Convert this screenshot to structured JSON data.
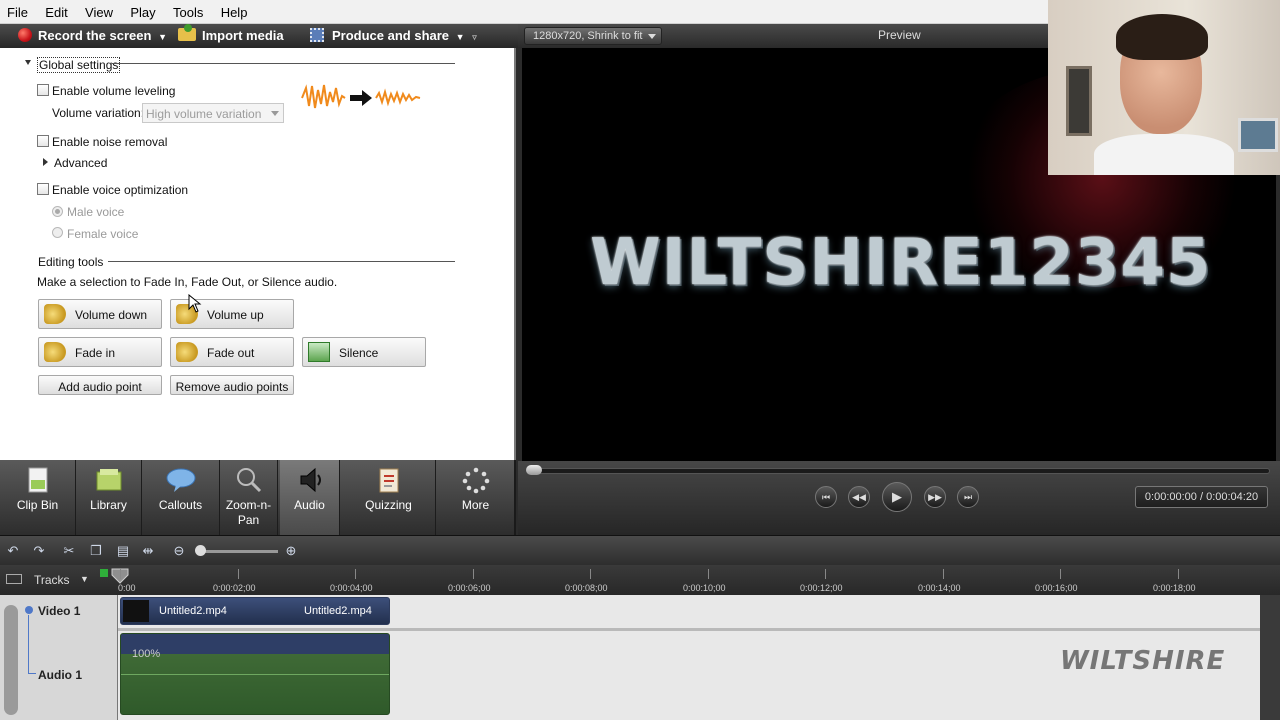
{
  "menu": [
    "File",
    "Edit",
    "View",
    "Play",
    "Tools",
    "Help"
  ],
  "toolbar": {
    "record": "Record the screen",
    "import": "Import media",
    "produce": "Produce and share"
  },
  "audio_panel": {
    "global_settings": "Global settings",
    "volume_leveling": "Enable volume leveling",
    "volume_variation_label": "Volume variation:",
    "volume_variation_value": "High volume variation",
    "noise_removal": "Enable noise removal",
    "advanced": "Advanced",
    "voice_optimization": "Enable voice optimization",
    "male_voice": "Male voice",
    "female_voice": "Female voice",
    "editing_tools": "Editing tools",
    "instructions": "Make a selection to Fade In, Fade Out, or Silence audio.",
    "buttons": {
      "volume_down": "Volume down",
      "volume_up": "Volume up",
      "fade_in": "Fade in",
      "fade_out": "Fade out",
      "silence": "Silence",
      "add_audio_point": "Add audio point",
      "remove_audio_points": "Remove audio points"
    }
  },
  "tabs": {
    "clip_bin": "Clip Bin",
    "library": "Library",
    "callouts": "Callouts",
    "zoom_pan_1": "Zoom-n-",
    "zoom_pan_2": "Pan",
    "audio": "Audio",
    "quizzing": "Quizzing",
    "more": "More"
  },
  "preview": {
    "size_option": "1280x720, Shrink to fit",
    "title": "Preview",
    "video_text": "WILTSHIRE12345",
    "time": "0:00:00:00 / 0:00:04:20"
  },
  "timeline": {
    "tracks_label": "Tracks",
    "ticks": [
      "0:00",
      "0:00:02;00",
      "0:00:04;00",
      "0:00:06;00",
      "0:00:08;00",
      "0:00:10;00",
      "0:00:12;00",
      "0:00:14;00",
      "0:00:16;00",
      "0:00:18;00"
    ],
    "video_track": "Video 1",
    "audio_track": "Audio 1",
    "clip1": "Untitled2.mp4",
    "clip2": "Untitled2.mp4",
    "audio_level": "100%",
    "watermark": "WILTSHIRE"
  },
  "colors": {
    "record": "#c8141a",
    "audio_clip": "#3f6a36",
    "video_clip": "#3d4f7a"
  }
}
